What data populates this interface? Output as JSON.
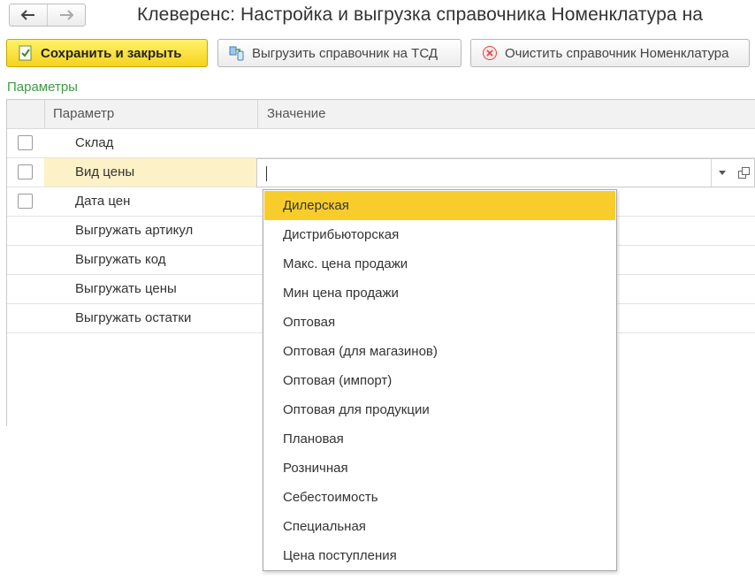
{
  "window": {
    "title": "Клеверенс: Настройка и выгрузка справочника Номенклатура на"
  },
  "toolbar": {
    "save_close_label": "Сохранить и закрыть",
    "upload_label": "Выгрузить справочник на ТСД",
    "clear_label": "Очистить справочник Номенклатура"
  },
  "parameters": {
    "group_title": "Параметры",
    "columns": {
      "param": "Параметр",
      "value": "Значение"
    },
    "rows": [
      {
        "label": "Склад",
        "has_checkbox": true
      },
      {
        "label": "Вид цены",
        "has_checkbox": true,
        "selected": true
      },
      {
        "label": "Дата цен",
        "has_checkbox": true
      },
      {
        "label": "Выгружать артикул",
        "has_checkbox": false
      },
      {
        "label": "Выгружать код",
        "has_checkbox": false
      },
      {
        "label": "Выгружать цены",
        "has_checkbox": false
      },
      {
        "label": "Выгружать остатки",
        "has_checkbox": false
      }
    ]
  },
  "value_editor": {
    "value": ""
  },
  "dropdown": {
    "highlighted_index": 0,
    "items": [
      "Дилерская",
      "Дистрибьюторская",
      "Макс. цена продажи",
      "Мин цена продажи",
      "Оптовая",
      "Оптовая (для магазинов)",
      "Оптовая (импорт)",
      "Оптовая для продукции",
      "Плановая",
      "Розничная",
      "Себестоимость",
      "Специальная",
      "Цена поступления"
    ]
  },
  "colors": {
    "primary_button": "#f5d21e",
    "highlight": "#f8cd2b",
    "selected_row": "#fdf1c7",
    "group_title": "#3e9b47"
  }
}
